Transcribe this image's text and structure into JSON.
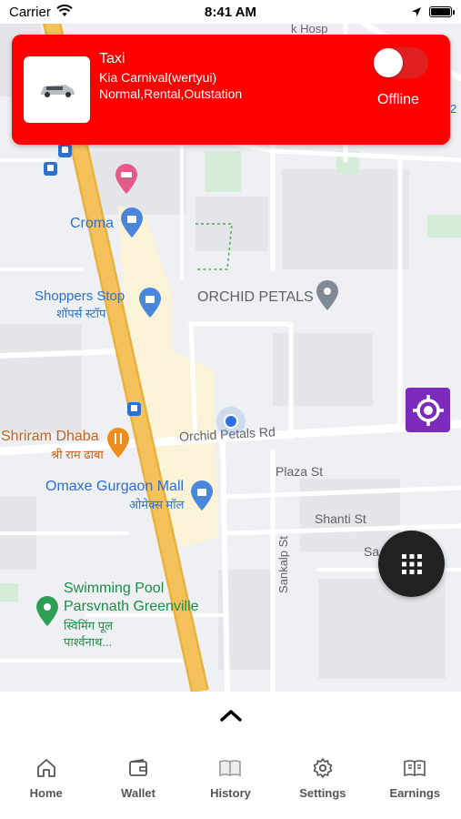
{
  "status_bar": {
    "carrier": "Carrier",
    "time": "8:41 AM"
  },
  "driver_card": {
    "vehicle_type": "Taxi",
    "vehicle_model": "Kia Carnival(wertyui)",
    "services": "Normal,Rental,Outstation",
    "status_label": "Offline",
    "online_toggle": false,
    "card_color": "#ff0000"
  },
  "map": {
    "pois": {
      "croma": "Croma",
      "shoppers_stop": "Shoppers Stop",
      "shoppers_stop_hi": "शॉपर्स स्टॉप",
      "orchid_petals": "ORCHID PETALS",
      "shriram_dhaba": "Shriram Dhaba",
      "shriram_dhaba_hi": "श्री राम ढाबा",
      "omaxe_mall": "Omaxe Gurgaon Mall",
      "omaxe_mall_hi": "ओमेक्स मॉल",
      "swimming_pool_1": "Swimming Pool",
      "swimming_pool_2": "Parsvnath Greenville",
      "swimming_pool_hi_1": "स्विमिंग पूल",
      "swimming_pool_hi_2": "पार्श्वनाथ..."
    },
    "streets": {
      "orchid_petals_rd": "Orchid Petals Rd",
      "plaza_st": "Plaza St",
      "shanti_st": "Shanti St",
      "sankalp_st": "Sankalp St",
      "sa_partial": "Sa"
    },
    "partial_labels": {
      "top_hosp": "k Hosp",
      "top_right": "2"
    }
  },
  "bottom_nav": {
    "tabs": [
      {
        "label": "Home",
        "icon": "home-icon"
      },
      {
        "label": "Wallet",
        "icon": "wallet-icon"
      },
      {
        "label": "History",
        "icon": "book-icon"
      },
      {
        "label": "Settings",
        "icon": "gear-icon"
      },
      {
        "label": "Earnings",
        "icon": "earnings-icon"
      }
    ]
  },
  "colors": {
    "accent_purple": "#7b2cbf",
    "fab_dark": "#212121",
    "road_yellow": "#f5c15b"
  }
}
